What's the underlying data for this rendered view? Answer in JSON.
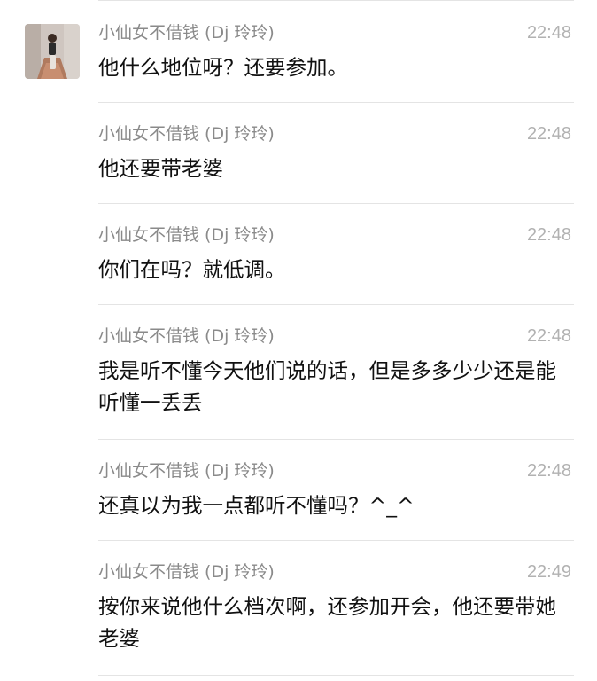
{
  "messages": [
    {
      "sender": "小仙女不借钱 (Dj 玲玲)",
      "time": "22:48",
      "text": "他什么地位呀？还要参加。"
    },
    {
      "sender": "小仙女不借钱 (Dj 玲玲)",
      "time": "22:48",
      "text": "他还要带老婆"
    },
    {
      "sender": "小仙女不借钱 (Dj 玲玲)",
      "time": "22:48",
      "text": "你们在吗？就低调。"
    },
    {
      "sender": "小仙女不借钱 (Dj 玲玲)",
      "time": "22:48",
      "text": "我是听不懂今天他们说的话，但是多多少少还是能听懂一丢丢"
    },
    {
      "sender": "小仙女不借钱 (Dj 玲玲)",
      "time": "22:48",
      "text": "还真以为我一点都听不懂吗？^_^"
    },
    {
      "sender": "小仙女不借钱 (Dj 玲玲)",
      "time": "22:49",
      "text": "按你来说他什么档次啊，还参加开会，他还要带她老婆"
    }
  ]
}
